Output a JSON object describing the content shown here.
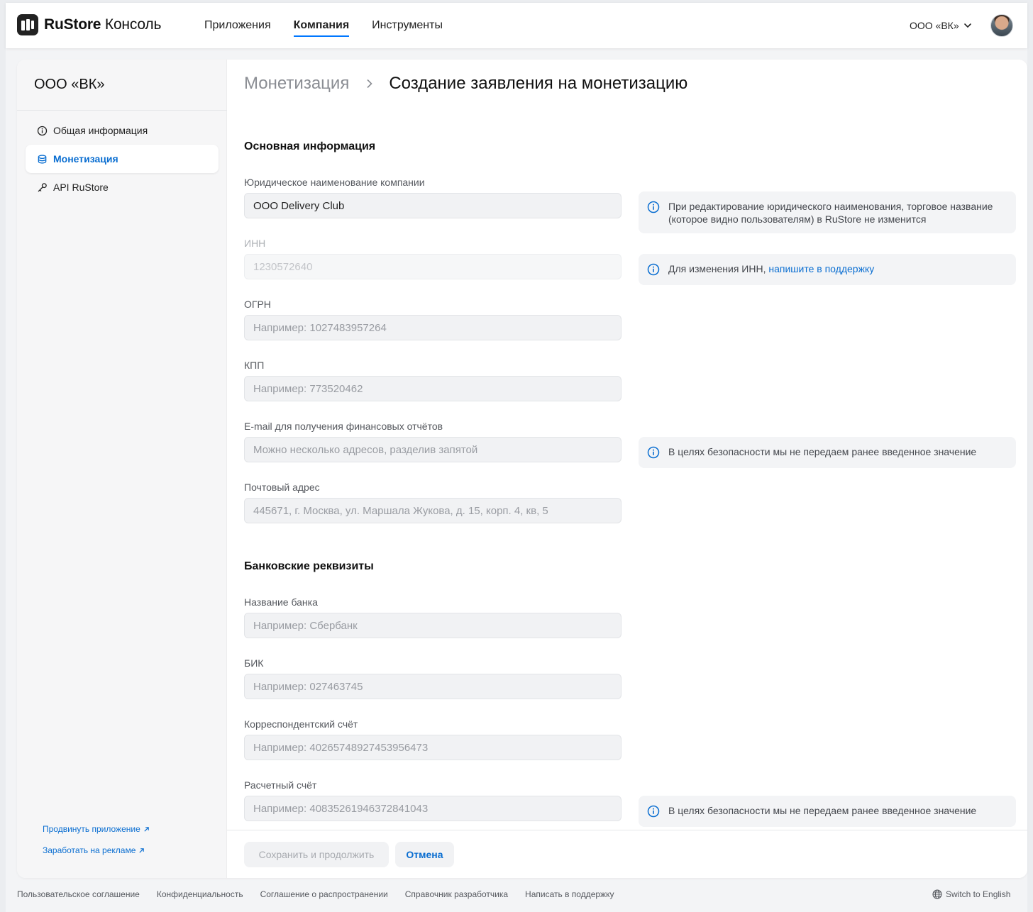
{
  "header": {
    "logo_brand": "RuStore",
    "logo_suffix": "Консоль",
    "nav": [
      {
        "label": "Приложения"
      },
      {
        "label": "Компания"
      },
      {
        "label": "Инструменты"
      }
    ],
    "org_name": "ООО «ВК»"
  },
  "sidebar": {
    "title": "ООО «ВК»",
    "items": [
      {
        "label": "Общая информация"
      },
      {
        "label": "Монетизация"
      },
      {
        "label": "API RuStore"
      }
    ],
    "links": [
      {
        "label": "Продвинуть приложение"
      },
      {
        "label": "Заработать на рекламе"
      }
    ]
  },
  "breadcrumb": {
    "parent": "Монетизация",
    "current": "Создание заявления на монетизацию"
  },
  "sections": {
    "main_info": "Основная информация",
    "bank": "Банковские реквизиты"
  },
  "fields": {
    "legal_name": {
      "label": "Юридическое наименование компании",
      "value": "ООО Delivery Club"
    },
    "inn": {
      "label": "ИНН",
      "value": "1230572640"
    },
    "ogrn": {
      "label": "ОГРН",
      "placeholder": "Например: 1027483957264"
    },
    "kpp": {
      "label": "КПП",
      "placeholder": "Например: 773520462"
    },
    "email": {
      "label": "E-mail для получения финансовых отчётов",
      "placeholder": "Можно несколько адресов, разделив запятой"
    },
    "address": {
      "label": "Почтовый адрес",
      "placeholder": "445671, г. Москва, ул. Маршала Жукова, д. 15, корп. 4, кв, 5"
    },
    "bank_name": {
      "label": "Название банка",
      "placeholder": "Например: Сбербанк"
    },
    "bik": {
      "label": "БИК",
      "placeholder": "Например: 027463745"
    },
    "corr_account": {
      "label": "Корреспондентский счёт",
      "placeholder": "Например: 40265748927453956473"
    },
    "account": {
      "label": "Расчетный счёт",
      "placeholder": "Например: 40835261946372841043"
    }
  },
  "hints": {
    "legal_name": "При редактирование юридического наименования, торговое название (которое видно пользователям) в RuStore не изменится",
    "inn_text": "Для изменения  ИНН,",
    "inn_link": "напишите в поддержку",
    "security": "В целях безопасности мы не передаем ранее введенное значение"
  },
  "actions": {
    "save": "Сохранить и продолжить",
    "cancel": "Отмена"
  },
  "footer": {
    "links": [
      {
        "label": "Пользовательское соглашение"
      },
      {
        "label": "Конфиденциальность"
      },
      {
        "label": "Соглашение о распространении"
      },
      {
        "label": "Справочник разработчика"
      },
      {
        "label": "Написать в поддержку"
      }
    ],
    "language": "Switch to English"
  },
  "colors": {
    "accent": "#0077ff",
    "link": "#0a6ed1"
  }
}
